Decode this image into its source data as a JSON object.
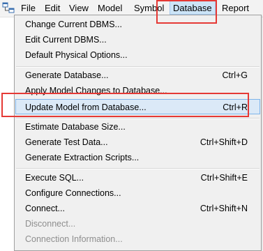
{
  "menubar": {
    "app_icon": "table-grid-icon",
    "items": [
      "File",
      "Edit",
      "View",
      "Model",
      "Symbol",
      "Database",
      "Report"
    ],
    "active_item": "Database"
  },
  "dropdown": {
    "groups": [
      [
        {
          "label": "Change Current DBMS...",
          "shortcut": "",
          "enabled": true
        },
        {
          "label": "Edit Current DBMS...",
          "shortcut": "",
          "enabled": true
        },
        {
          "label": "Default Physical Options...",
          "shortcut": "",
          "enabled": true
        }
      ],
      [
        {
          "label": "Generate Database...",
          "shortcut": "Ctrl+G",
          "enabled": true
        },
        {
          "label": "Apply Model Changes to Database...",
          "shortcut": "",
          "enabled": true
        },
        {
          "label": "Update Model from Database...",
          "shortcut": "Ctrl+R",
          "enabled": true,
          "highlighted": true
        }
      ],
      [
        {
          "label": "Estimate Database Size...",
          "shortcut": "",
          "enabled": true
        },
        {
          "label": "Generate Test Data...",
          "shortcut": "Ctrl+Shift+D",
          "enabled": true
        },
        {
          "label": "Generate Extraction Scripts...",
          "shortcut": "",
          "enabled": true
        }
      ],
      [
        {
          "label": "Execute SQL...",
          "shortcut": "Ctrl+Shift+E",
          "enabled": true
        },
        {
          "label": "Configure Connections...",
          "shortcut": "",
          "enabled": true
        },
        {
          "label": "Connect...",
          "shortcut": "Ctrl+Shift+N",
          "enabled": true
        },
        {
          "label": "Disconnect...",
          "shortcut": "",
          "enabled": false
        },
        {
          "label": "Connection Information...",
          "shortcut": "",
          "enabled": false
        }
      ]
    ]
  },
  "colors": {
    "annotation": "#e53935",
    "highlight_bg": "#dbe9f7",
    "highlight_border": "#7eb4ea",
    "menu_bg": "#f0f0f0",
    "disabled_text": "#8e8e8e"
  }
}
